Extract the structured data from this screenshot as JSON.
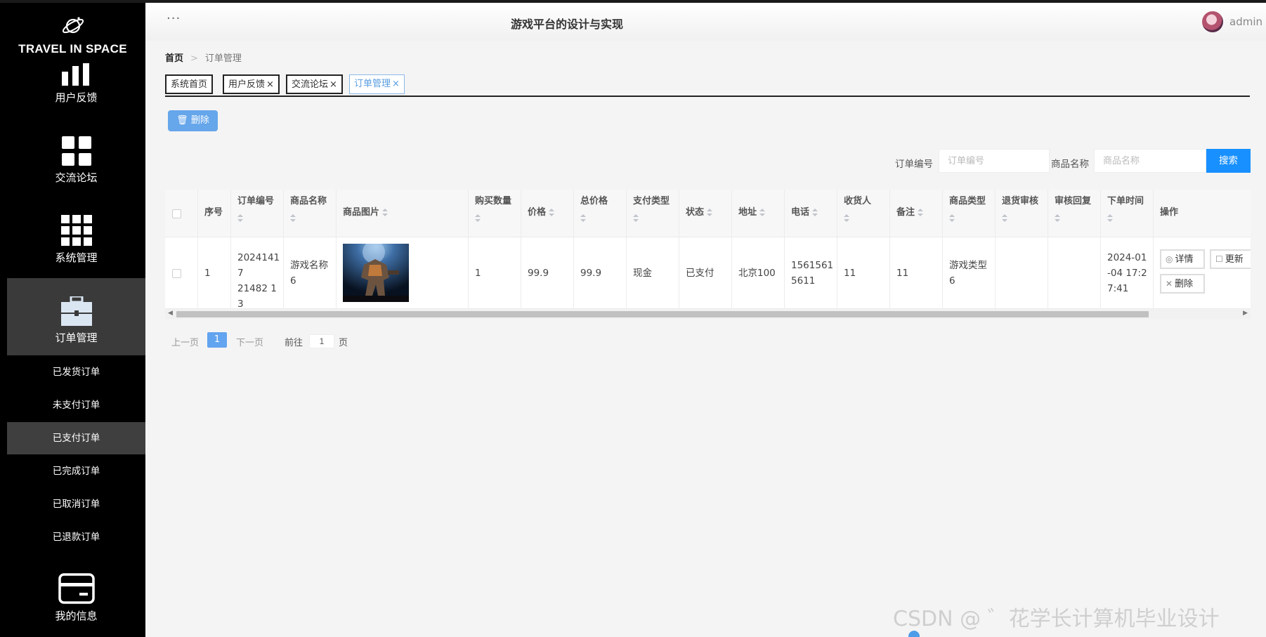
{
  "app": {
    "logo_text": "TRAVEL IN SPACE",
    "title": "游戏平台的设计与实现",
    "user": "admin"
  },
  "sidebar": {
    "items": [
      {
        "label": "用户反馈",
        "icon": "bar-chart-icon"
      },
      {
        "label": "交流论坛",
        "icon": "grid-four-icon"
      },
      {
        "label": "系统管理",
        "icon": "grid-nine-icon"
      },
      {
        "label": "订单管理",
        "icon": "briefcase-icon",
        "active": true
      },
      {
        "label": "我的信息",
        "icon": "card-icon"
      }
    ],
    "sub_items": [
      {
        "label": "已发货订单"
      },
      {
        "label": "未支付订单"
      },
      {
        "label": "已支付订单",
        "active": true
      },
      {
        "label": "已完成订单"
      },
      {
        "label": "已取消订单"
      },
      {
        "label": "已退款订单"
      }
    ]
  },
  "breadcrumb": {
    "home": "首页",
    "sep": ">",
    "current": "订单管理"
  },
  "tabs": [
    {
      "label": "系统首页",
      "closable": false
    },
    {
      "label": "用户反馈",
      "closable": true
    },
    {
      "label": "交流论坛",
      "closable": true
    },
    {
      "label": "订单管理",
      "closable": true,
      "active": true
    }
  ],
  "toolbar": {
    "delete_label": "删除"
  },
  "search": {
    "order_no_label": "订单编号",
    "order_no_placeholder": "订单编号",
    "product_label": "商品名称",
    "product_placeholder": "商品名称",
    "button": "搜索"
  },
  "table": {
    "headers": [
      "序号",
      "订单编号",
      "商品名称",
      "商品图片",
      "购买数量",
      "价格",
      "总价格",
      "支付类型",
      "状态",
      "地址",
      "电话",
      "收货人",
      "备注",
      "商品类型",
      "退货审核",
      "审核回复",
      "下单时间",
      "操作"
    ],
    "rows": [
      {
        "index": "1",
        "order_no": "2024141721482 13",
        "order_no_lines": [
          "20241417",
          "21482 1",
          "3"
        ],
        "product_name_lines": [
          "游戏名称",
          "6"
        ],
        "quantity": "1",
        "price": "99.9",
        "total": "99.9",
        "pay_type": "现金",
        "status": "已支付",
        "address": "北京100",
        "phone_lines": [
          "1561561",
          "5611"
        ],
        "receiver": "11",
        "remark": "11",
        "product_type_lines": [
          "游戏类型",
          "6"
        ],
        "return_review": "",
        "review_reply": "",
        "time_lines": [
          "2024-01",
          "-04 17:2",
          "7:41"
        ],
        "actions": {
          "detail": "详情",
          "update": "更新",
          "delete": "删除"
        }
      }
    ]
  },
  "pagination": {
    "prev": "上一页",
    "current": "1",
    "next": "下一页",
    "goto_label": "前往",
    "goto_value": "1",
    "page_suffix": "页"
  },
  "watermark": "CSDN @ ゛花学长计算机毕业设计",
  "colors": {
    "primary": "#1890ff",
    "sidebar_bg": "#000000",
    "active_bg": "#3a3a3a"
  }
}
